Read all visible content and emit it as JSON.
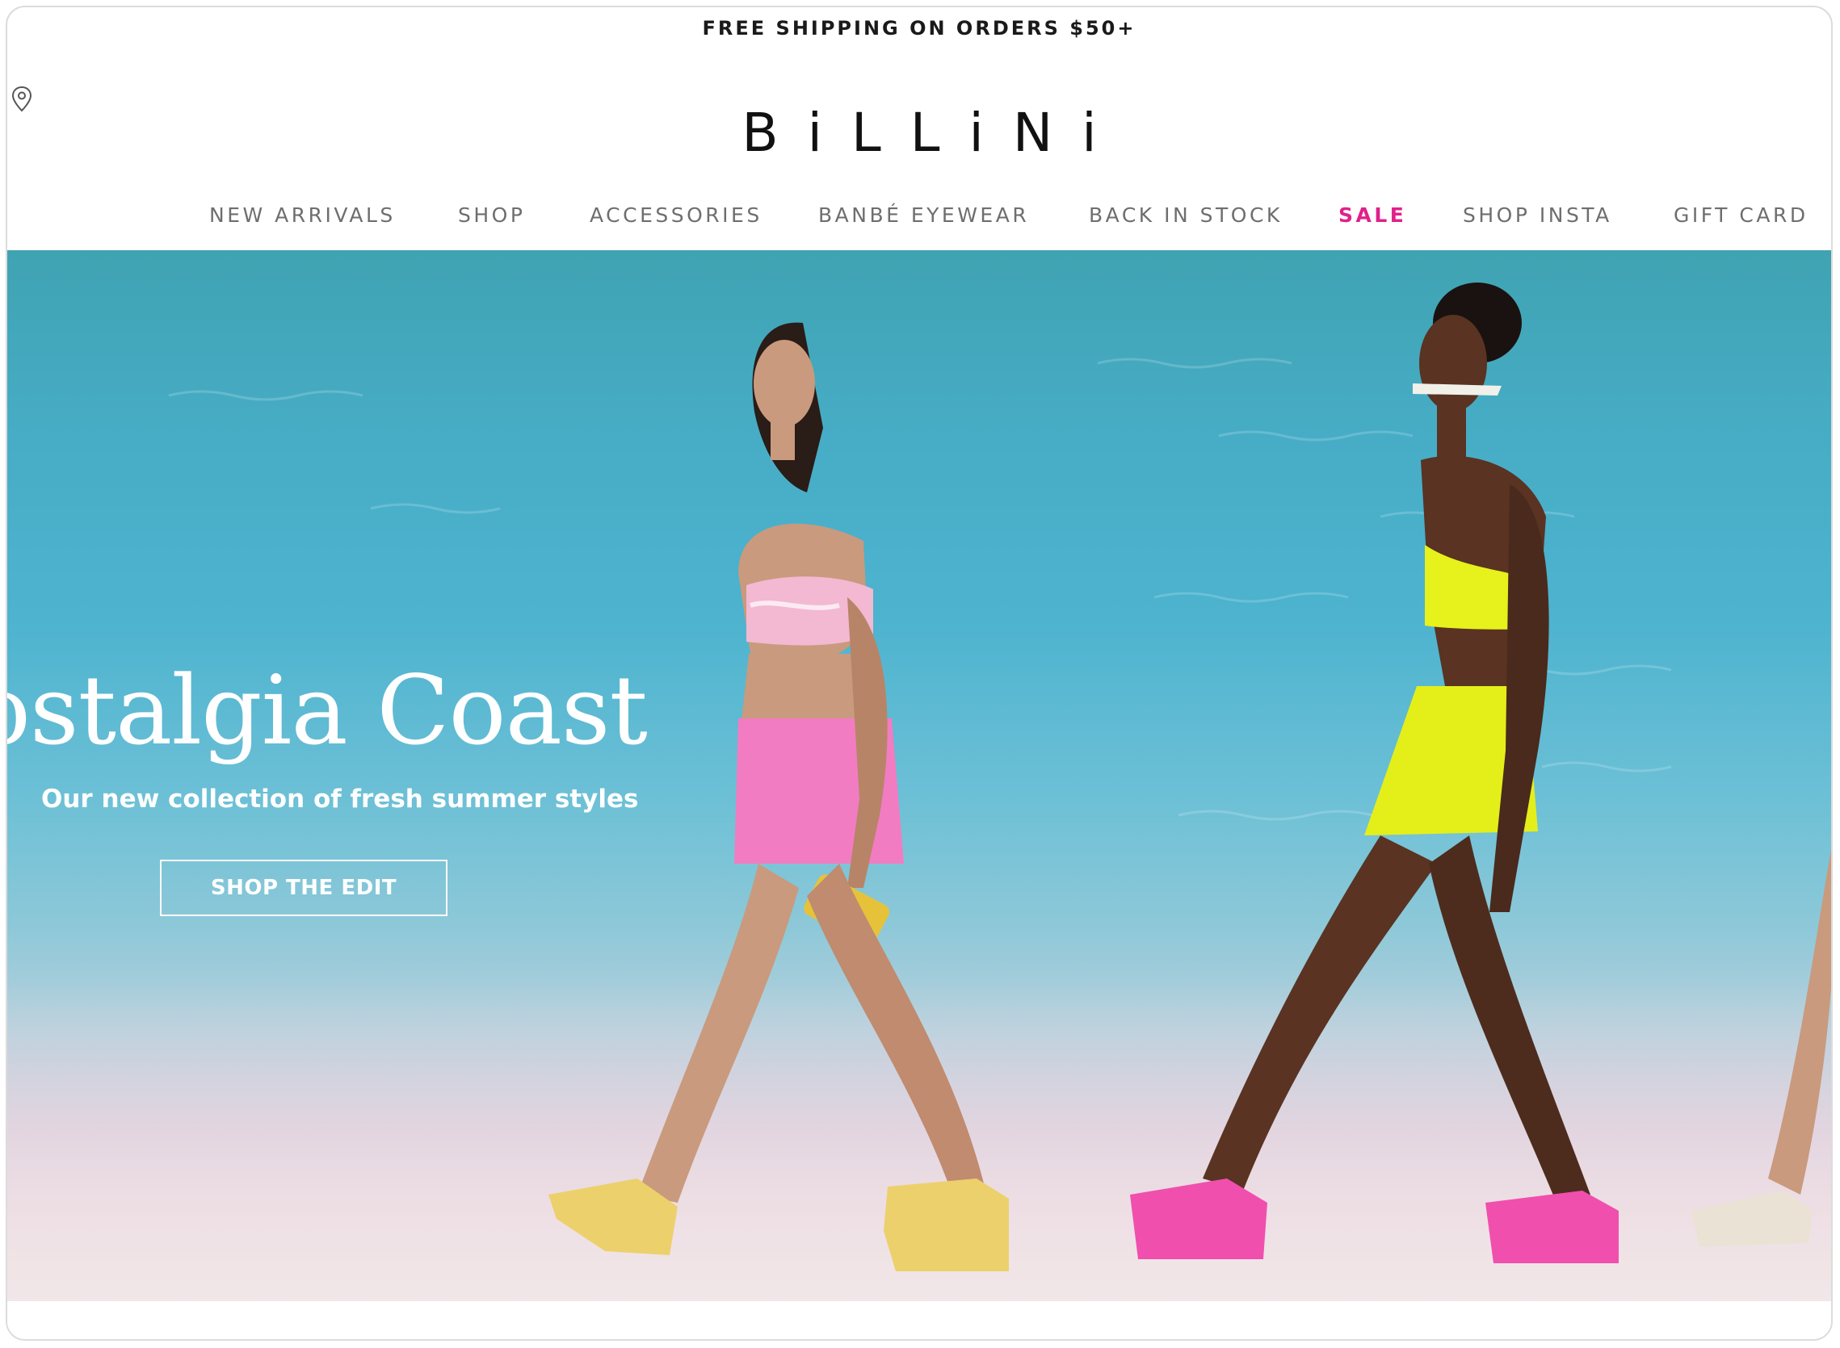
{
  "announcement": {
    "text": "FREE SHIPPING ON ORDERS $50+"
  },
  "header": {
    "logo": "BiLLiNi",
    "location_icon": "location-pin-icon"
  },
  "nav": {
    "items": [
      {
        "label": "NEW ARRIVALS"
      },
      {
        "label": "SHOP"
      },
      {
        "label": "ACCESSORIES"
      },
      {
        "label": "BANBÉ EYEWEAR"
      },
      {
        "label": "BACK IN STOCK"
      },
      {
        "label": "SALE"
      },
      {
        "label": "SHOP INSTA"
      },
      {
        "label": "GIFT CARD"
      }
    ]
  },
  "hero": {
    "title": "ostalgia Coast",
    "subtitle": "Our new collection of fresh summer styles",
    "cta_label": "SHOP THE EDIT"
  },
  "colors": {
    "sale": "#e0218a",
    "nav_text": "#6e6e6e",
    "water": "#4db3cf",
    "sand": "#efe2e6"
  }
}
